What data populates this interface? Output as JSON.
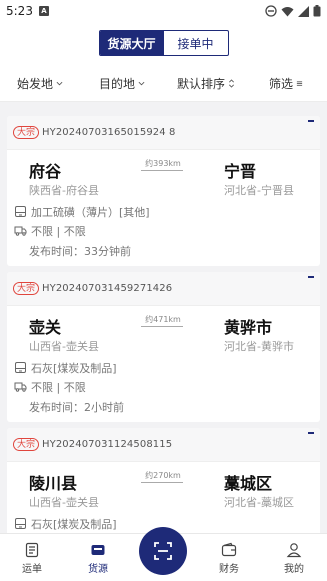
{
  "status_bar": {
    "time": "5:23",
    "notif_icon": "A"
  },
  "header": {
    "tabs": [
      "货源大厅",
      "接单中"
    ],
    "active_tab": 0
  },
  "filters": [
    {
      "label": "始发地",
      "icon": "chevron-down-icon"
    },
    {
      "label": "目的地",
      "icon": "chevron-down-icon"
    },
    {
      "label": "默认排序",
      "icon": "sort-icon"
    },
    {
      "label": "筛选",
      "icon": "filter-icon"
    }
  ],
  "orders": [
    {
      "badge": "大宗",
      "order_no": "HY20240703165015924 8",
      "from_city": "府谷",
      "from_prov": "陕西省-府谷县",
      "distance": "约393km",
      "to_city": "宁晋",
      "to_prov": "河北省-宁晋县",
      "cargo": "加工硫磺（薄片）[其他]",
      "vehicle": "不限 | 不限",
      "published": "发布时间：33分钟前"
    },
    {
      "badge": "大宗",
      "order_no": "HY202407031459271426",
      "from_city": "壶关",
      "from_prov": "山西省-壶关县",
      "distance": "约471km",
      "to_city": "黄骅市",
      "to_prov": "河北省-黄骅市",
      "cargo": "石灰[煤炭及制品]",
      "vehicle": "不限 | 不限",
      "published": "发布时间：2小时前"
    },
    {
      "badge": "大宗",
      "order_no": "HY202407031124508115",
      "from_city": "陵川县",
      "from_prov": "山西省-壶关县",
      "distance": "约270km",
      "to_city": "藁城区",
      "to_prov": "河北省-藁城区",
      "cargo": "石灰[煤炭及制品]",
      "vehicle": "",
      "published": ""
    }
  ],
  "tabbar": {
    "items": [
      {
        "label": "运单",
        "icon": "document-icon"
      },
      {
        "label": "货源",
        "icon": "wallet-icon"
      },
      {
        "label": "财务",
        "icon": "finance-icon"
      },
      {
        "label": "我的",
        "icon": "profile-icon"
      }
    ],
    "active": 1,
    "scan_icon": "scan-icon"
  },
  "colors": {
    "primary": "#1e2a78",
    "badge": "#e0453d"
  }
}
